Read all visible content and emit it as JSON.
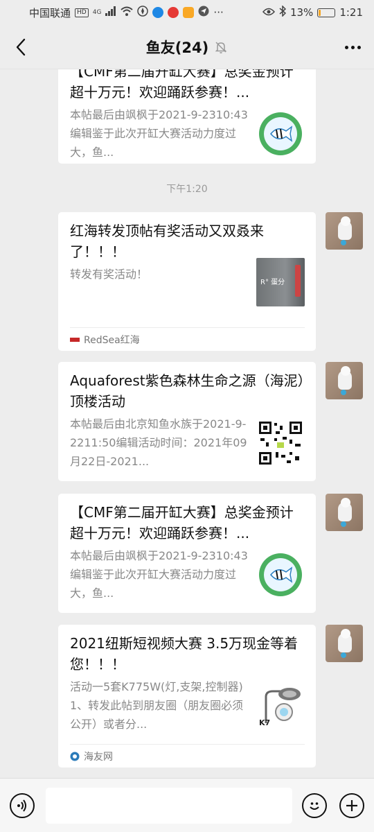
{
  "status_bar": {
    "carrier": "中国联通",
    "net_badge": "HD",
    "net_type": "4G",
    "battery_percent": "13%",
    "battery_level": 0.13,
    "time": "1:21",
    "more": "···"
  },
  "nav": {
    "title": "鱼友(24)"
  },
  "messages": [
    {
      "title": "【CMF第二届开缸大赛】总奖金预计超十万元！欢迎踊跃参赛！...",
      "desc": "本帖最后由飒枫于2021-9-2310:43编辑鉴于此次开缸大赛活动力度过大，鱼..."
    },
    {
      "title": "红海转发顶帖有奖活动又双叒来了！！！",
      "desc": "转发有奖活动！",
      "thumb_text": "R° 蛋分",
      "source": "RedSea红海"
    },
    {
      "title": "Aquaforest紫色森林生命之源（海泥）顶楼活动",
      "desc": "本帖最后由北京知鱼水族于2021-9-2211:50编辑活动时间：2021年09月22日-2021..."
    },
    {
      "title": "【CMF第二届开缸大赛】总奖金预计超十万元！欢迎踊跃参赛！...",
      "desc": "本帖最后由飒枫于2021-9-2310:43编辑鉴于此次开缸大赛活动力度过大，鱼..."
    },
    {
      "title": "2021纽斯短视频大赛 3.5万现金等着您！！！",
      "desc": "活动一5套K775W(灯,支架,控制器)1、转发此帖到朋友圈（朋友圈必须公开）或者分...",
      "thumb_text": "K7",
      "source": "海友网"
    }
  ],
  "timestamp": "下午1:20",
  "input": {
    "placeholder": ""
  }
}
